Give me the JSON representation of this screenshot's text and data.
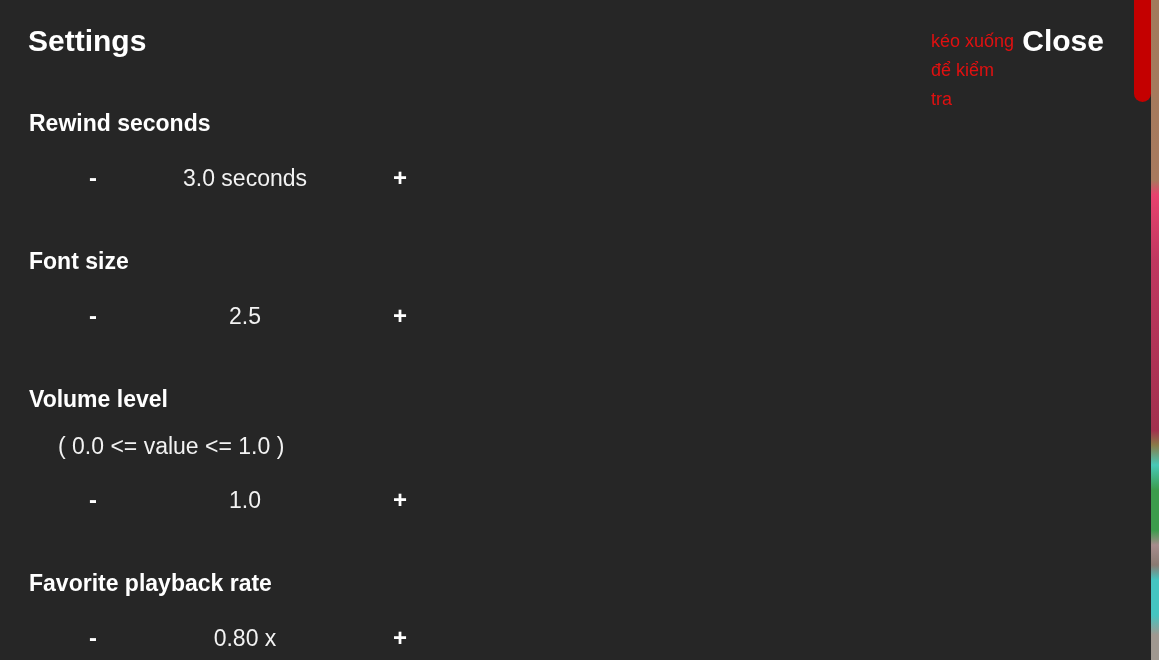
{
  "header": {
    "title": "Settings",
    "annotation": "kéo xuống để kiểm tra",
    "close_button": "Close"
  },
  "settings": [
    {
      "label": "Rewind seconds",
      "decrement": "-",
      "value": "3.0 seconds",
      "increment": "+"
    },
    {
      "label": "Font size",
      "decrement": "-",
      "value": "2.5",
      "increment": "+"
    },
    {
      "label": "Volume level",
      "hint": "( 0.0 <= value <= 1.0 )",
      "decrement": "-",
      "value": "1.0",
      "increment": "+"
    },
    {
      "label": "Favorite playback rate",
      "decrement": "-",
      "value": "0.80 x",
      "increment": "+"
    }
  ]
}
